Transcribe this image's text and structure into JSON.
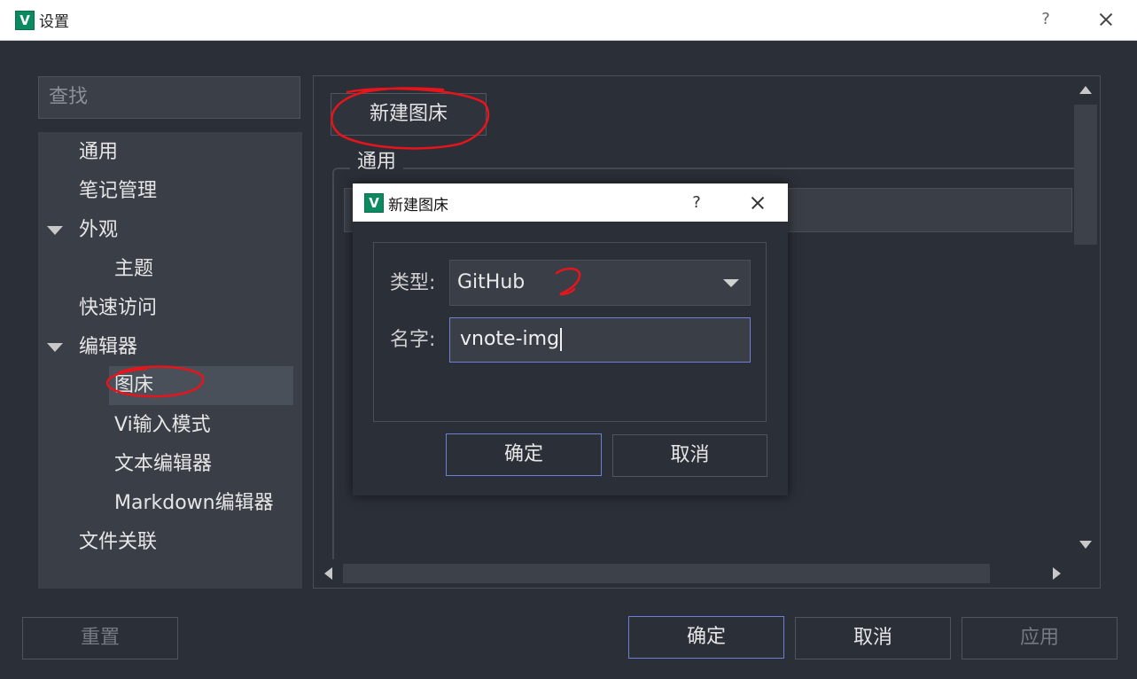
{
  "window": {
    "title": "设置",
    "icon_letter": "V",
    "help_glyph": "?"
  },
  "search": {
    "placeholder": "查找"
  },
  "tree": {
    "items": [
      {
        "label": "通用"
      },
      {
        "label": "笔记管理"
      },
      {
        "label": "外观",
        "expanded": true
      },
      {
        "label": "主题"
      },
      {
        "label": "快速访问"
      },
      {
        "label": "编辑器",
        "expanded": true
      },
      {
        "label": "图床",
        "selected": true
      },
      {
        "label": "Vi输入模式"
      },
      {
        "label": "文本编辑器"
      },
      {
        "label": "Markdown编辑器"
      },
      {
        "label": "文件关联"
      }
    ]
  },
  "panel": {
    "new_host_button": "新建图床",
    "group_title": "通用"
  },
  "footer": {
    "reset": "重置",
    "ok": "确定",
    "cancel": "取消",
    "apply": "应用"
  },
  "dialog": {
    "title": "新建图床",
    "icon_letter": "V",
    "help_glyph": "?",
    "type_label": "类型:",
    "type_value": "GitHub",
    "name_label": "名字:",
    "name_value": "vnote-img",
    "ok": "确定",
    "cancel": "取消"
  },
  "colors": {
    "background": "#2b2f37",
    "accent_border": "#6f7ed6",
    "annotation_red": "#e8141b",
    "app_icon_green": "#0b8a5f"
  }
}
